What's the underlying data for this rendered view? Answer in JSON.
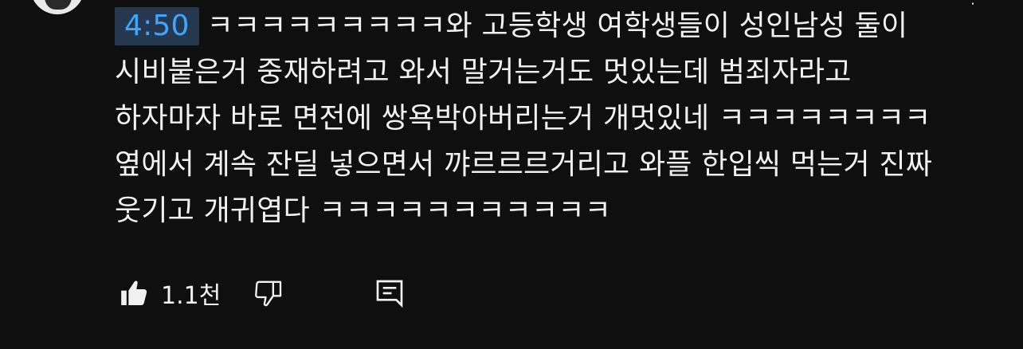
{
  "comment": {
    "timestamp": "4:50",
    "text": "ㅋㅋㅋㅋㅋㅋㅋㅋㅋ와 고등학생 여학생들이 성인남성 둘이 시비붙은거 중재하려고 와서 말거는거도 멋있는데 범죄자라고 하자마자 바로 면전에 쌍욕박아버리는거 개멋있네 ㅋㅋㅋㅋㅋㅋㅋㅋ 옆에서 계속 잔딜 넣으면서 꺄르르르거리고 와플 한입씩 먹는거 진짜 웃기고 개귀엽다 ㅋㅋㅋㅋㅋㅋㅋㅋㅋㅋㅋ"
  },
  "actions": {
    "like_count": "1.1천"
  },
  "icons": {
    "like": "thumbs-up-icon",
    "dislike": "thumbs-down-icon",
    "reply": "comment-reply-icon",
    "menu": "more-vertical-icon"
  },
  "colors": {
    "background": "#0f0f0f",
    "text": "#f1f1f1",
    "timestamp_bg": "#263850",
    "timestamp_text": "#3ea6ff"
  }
}
